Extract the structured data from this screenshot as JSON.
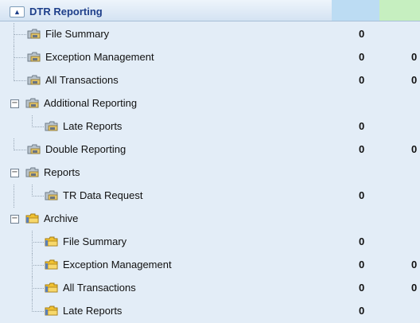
{
  "header": {
    "toggle_glyph": "▲",
    "title": "DTR Reporting",
    "column_colors": [
      "#bcdcf3",
      "#c6efc0"
    ]
  },
  "tree": [
    {
      "label": "File Summary",
      "c1": "0",
      "c2": "",
      "folder": "gray"
    },
    {
      "label": "Exception Management",
      "c1": "0",
      "c2": "0",
      "folder": "gray"
    },
    {
      "label": "All Transactions",
      "c1": "0",
      "c2": "0",
      "folder": "gray"
    },
    {
      "label": "Additional Reporting",
      "c1": "",
      "c2": "",
      "folder": "gray",
      "expanded": true
    },
    {
      "label": "Late Reports",
      "c1": "0",
      "c2": "",
      "folder": "gray"
    },
    {
      "label": "Double Reporting",
      "c1": "0",
      "c2": "0",
      "folder": "gray"
    },
    {
      "label": "Reports",
      "c1": "",
      "c2": "",
      "folder": "gray",
      "expanded": true
    },
    {
      "label": "TR Data Request",
      "c1": "0",
      "c2": "",
      "folder": "gray"
    },
    {
      "label": "Archive",
      "c1": "",
      "c2": "",
      "folder": "yellow",
      "expanded": true
    },
    {
      "label": "File Summary",
      "c1": "0",
      "c2": "",
      "folder": "yellow"
    },
    {
      "label": "Exception Management",
      "c1": "0",
      "c2": "0",
      "folder": "yellow"
    },
    {
      "label": "All Transactions",
      "c1": "0",
      "c2": "0",
      "folder": "yellow"
    },
    {
      "label": "Late Reports",
      "c1": "0",
      "c2": "",
      "folder": "yellow"
    }
  ],
  "colors": {
    "panel_bg": "#e3edf7",
    "title_color": "#1e3f8a"
  },
  "icons": {
    "collapse": "collapse-toggle-icon",
    "folder_gray": "report-folder-icon",
    "folder_yellow": "archive-folder-icon"
  }
}
